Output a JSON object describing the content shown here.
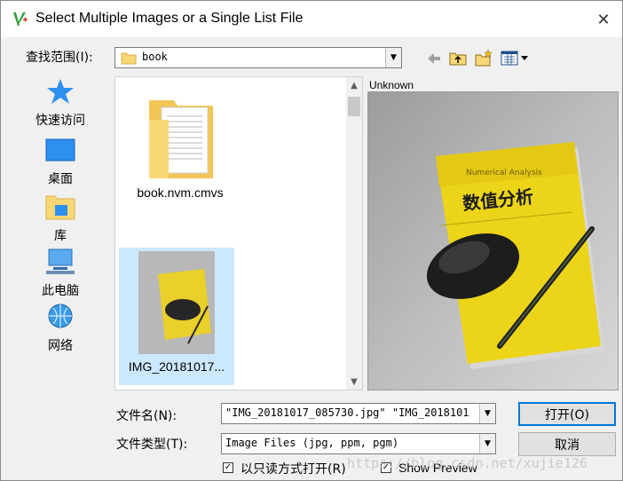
{
  "window": {
    "title": "Select Multiple Images or a Single List File"
  },
  "lookin": {
    "label": "查找范围(I):",
    "value": "book"
  },
  "places": [
    {
      "label": "快速访问",
      "icon": "star-icon"
    },
    {
      "label": "桌面",
      "icon": "desktop-icon"
    },
    {
      "label": "库",
      "icon": "library-icon"
    },
    {
      "label": "此电脑",
      "icon": "computer-icon"
    },
    {
      "label": "网络",
      "icon": "network-icon"
    }
  ],
  "files": [
    {
      "name": "book.nvm.cmvs",
      "type": "folder"
    },
    {
      "name": "IMG_20181017...",
      "type": "image"
    }
  ],
  "preview": {
    "label": "Unknown",
    "book_title_cn": "数值分析",
    "book_title_en": "Numerical Analysis"
  },
  "filename": {
    "label": "文件名(N):",
    "value": "\"IMG_20181017_085730.jpg\" \"IMG_2018101"
  },
  "filetype": {
    "label": "文件类型(T):",
    "value": "Image Files (jpg, ppm, pgm)"
  },
  "buttons": {
    "open": "打开(O)",
    "cancel": "取消"
  },
  "readonly": {
    "label": "以只读方式打开(R)",
    "checked": true
  },
  "showpreview": {
    "label": "Show Preview",
    "checked": true
  },
  "watermark": "https://blog.csdn.net/xujie126"
}
